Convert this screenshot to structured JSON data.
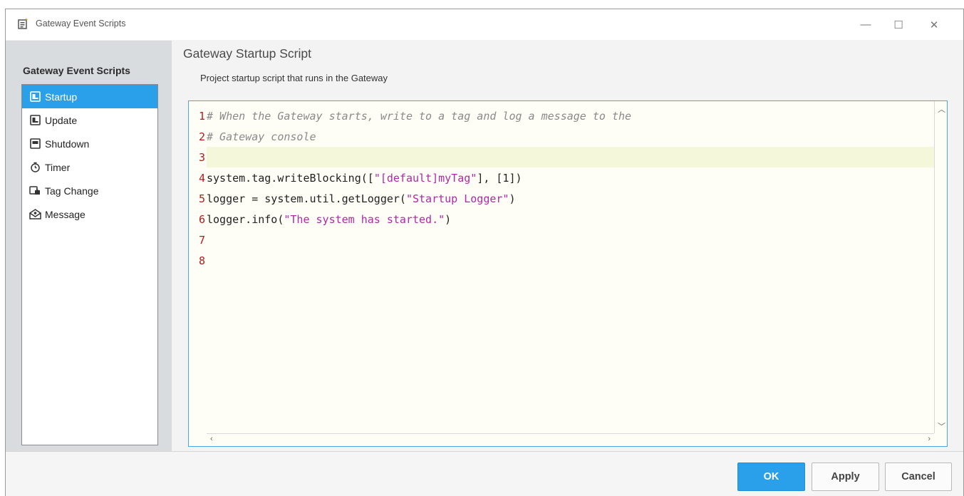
{
  "window": {
    "title": "Gateway Event Scripts",
    "icon": "scripts-icon",
    "controls": {
      "minimize": "—",
      "maximize": "☐",
      "close": "✕"
    }
  },
  "sidebar": {
    "title": "Gateway Event Scripts",
    "items": [
      {
        "label": "Startup",
        "icon": "script-icon",
        "selected": true
      },
      {
        "label": "Update",
        "icon": "script-icon",
        "selected": false
      },
      {
        "label": "Shutdown",
        "icon": "script-icon",
        "selected": false
      },
      {
        "label": "Timer",
        "icon": "timer-icon",
        "selected": false
      },
      {
        "label": "Tag Change",
        "icon": "tag-change-icon",
        "selected": false
      },
      {
        "label": "Message",
        "icon": "message-icon",
        "selected": false
      }
    ]
  },
  "main": {
    "title": "Gateway Startup Script",
    "description": "Project startup script that runs in the Gateway"
  },
  "editor": {
    "current_line": 3,
    "lines": [
      {
        "num": "1",
        "segments": [
          {
            "t": "cm",
            "text": "# When the Gateway starts, write to a tag and log a message to the"
          }
        ]
      },
      {
        "num": "2",
        "segments": [
          {
            "t": "cm",
            "text": "# Gateway console"
          }
        ]
      },
      {
        "num": "3",
        "segments": []
      },
      {
        "num": "4",
        "segments": [
          {
            "t": "pl",
            "text": "system.tag.writeBlocking(["
          },
          {
            "t": "st",
            "text": "\"[default]myTag\""
          },
          {
            "t": "pl",
            "text": "], [1])"
          }
        ]
      },
      {
        "num": "5",
        "segments": [
          {
            "t": "pl",
            "text": "logger = system.util.getLogger("
          },
          {
            "t": "st",
            "text": "\"Startup Logger\""
          },
          {
            "t": "pl",
            "text": ")"
          }
        ]
      },
      {
        "num": "6",
        "segments": [
          {
            "t": "pl",
            "text": "logger.info("
          },
          {
            "t": "st",
            "text": "\"The system has started.\""
          },
          {
            "t": "pl",
            "text": ")"
          }
        ]
      },
      {
        "num": "7",
        "segments": []
      },
      {
        "num": "8",
        "segments": []
      }
    ]
  },
  "footer": {
    "ok_label": "OK",
    "apply_label": "Apply",
    "cancel_label": "Cancel"
  },
  "colors": {
    "accent": "#2aa0eb",
    "line_number": "#b51b1b",
    "string": "#b227a6",
    "comment": "#8a8a8a",
    "current_line_bg": "#f4f7d9"
  }
}
